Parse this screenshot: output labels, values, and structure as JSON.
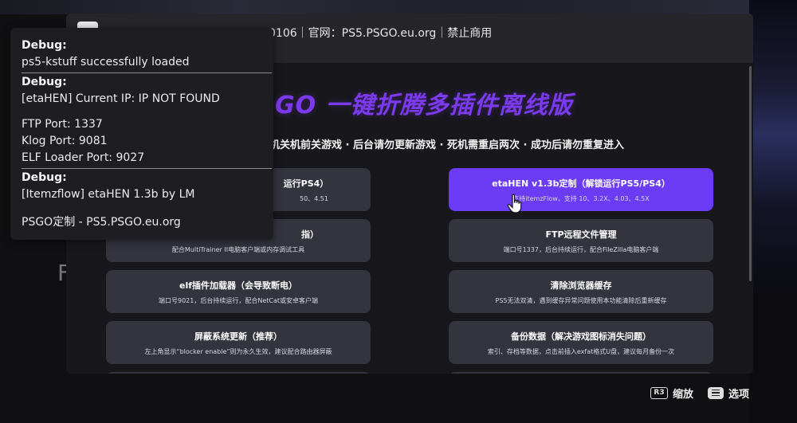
{
  "window": {
    "title": "0106｜官网：PS5.PSGO.eu.org｜禁止商用"
  },
  "main": {
    "heading": "GO 一键折腾多插件离线版",
    "notice": "机关机前关游戏 · 后台请勿更新游戏 · 死机需重启两次 · 成功后请勿重复进入",
    "buttons": [
      {
        "title": "运行PS4）",
        "sub": "50、4.51"
      },
      {
        "title": "etaHEN v1.3b定制（解锁运行PS5/PS4）",
        "sub": "支持itemzFlow，支持 10、3.2X、4.03、4.5X"
      },
      {
        "title": "指）",
        "sub": "配合MultiTrainer II电脑客户端或内存调试工具"
      },
      {
        "title": "FTP远程文件管理",
        "sub": "端口号1337，后台持续运行，配合FileZilla电脑客户端"
      },
      {
        "title": "elf插件加载器（会导致断电）",
        "sub": "端口号9021，后台持续运行，配合NetCat或安卓客户端"
      },
      {
        "title": "清除浏览器缓存",
        "sub": "PS5无法双清，遇到缓存异常问题使用本功能清除后重新缓存"
      },
      {
        "title": "屏蔽系统更新（推荐）",
        "sub": "左上角显示“blocker enable”则为永久生效，建议配合路由器屏蔽"
      },
      {
        "title": "备份数据（解决游戏图标消失问题）",
        "sub": "索引、存档等数据，点击前插入exfat格式U盘，建议每月备份一次"
      }
    ]
  },
  "debug": {
    "line1": "Debug:",
    "line2": "ps5-kstuff successfully loaded",
    "line3": "Debug:",
    "line4": "[etaHEN] Current IP: IP NOT FOUND",
    "line5": "FTP Port: 1337",
    "line6": "Klog Port: 9081",
    "line7": "ELF Loader Port: 9027",
    "line8": "Debug:",
    "line9": "[Itemzflow] etaHEN 1.3b by LM",
    "line10": "PSGO定制 - PS5.PSGO.eu.org"
  },
  "footer": {
    "zoom_key": "R3",
    "zoom_label": "缩放",
    "options_label": "选项"
  },
  "background": {
    "left_letter": "F"
  },
  "colors": {
    "accent": "#7c3aed",
    "active_button": "#6b3bf5",
    "button": "#34343f"
  }
}
